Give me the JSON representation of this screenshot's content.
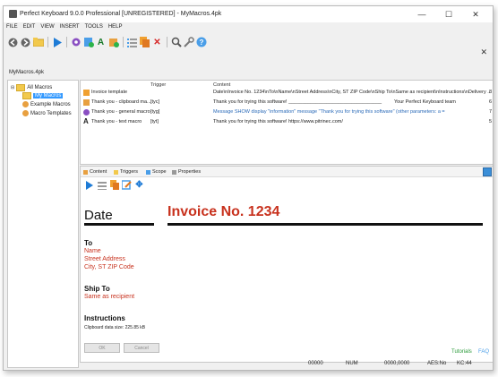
{
  "window": {
    "title": "Perfect Keyboard 9.0.0 Professional [UNREGISTERED] - MyMacros.4pk",
    "minimize": "—",
    "maximize": "☐",
    "close": "✕"
  },
  "menu": [
    "FILE",
    "EDIT",
    "VIEW",
    "INSERT",
    "TOOLS",
    "HELP"
  ],
  "close_x": "✕",
  "path_label": "MyMacros.4pk",
  "tree": {
    "root": "All Macros",
    "items": [
      "My Macros",
      "Example Macros",
      "Macro Templates"
    ]
  },
  "list": {
    "headers": {
      "trigger": "Trigger",
      "content": "Content",
      "num": "#"
    },
    "rows": [
      {
        "name": "Invoice template",
        "trigger": "",
        "content": "Date\\nInvoice No. 1234\\nTo\\nName\\nStreet Address\\nCity, ST ZIP Code\\nShip To\\nSame as recipient\\nInstructions\\nDelivery ...",
        "content2": "",
        "num": "8"
      },
      {
        "name": "Thank you - clipboard ma...",
        "trigger": "[tyc]",
        "content": "Thank you for trying this software! __________________________________",
        "content2": "Your Perfect Keyboard team",
        "num": "6"
      },
      {
        "name": "Thank you - general macro",
        "trigger": "[tyg]",
        "content": "Message SHOW display \"information\" message \"Thank you for trying this software\" (other parameters: a =",
        "content2": "",
        "num": "7"
      },
      {
        "name": "Thank you - text macro",
        "trigger": "[tyt]",
        "content": "Thank you for trying this software! https://www.pitrinec.com/",
        "content2": "",
        "num": "5"
      }
    ]
  },
  "editor": {
    "tabs": [
      "Content",
      "Triggers",
      "Scope",
      "Properties"
    ],
    "date_label": "Date",
    "invoice_title": "Invoice No. 1234",
    "to_label": "To",
    "to_lines": [
      "Name",
      "Street Address",
      "City, ST ZIP Code"
    ],
    "ship_label": "Ship To",
    "ship_line": "Same as recipient",
    "instructions_label": "Instructions",
    "clipboard_size": "Clipboard data size: 225.85 kB",
    "ok": "OK",
    "cancel": "Cancel"
  },
  "status": {
    "tutorials": "Tutorials",
    "faq": "FAQ",
    "s1": "00000",
    "s2": "NUM",
    "s3": "0000,0000",
    "s4": "AES:No",
    "s5": "KC:44"
  },
  "colors": {
    "accent_red": "#c8321e",
    "selection": "#3399ff",
    "tutorials": "#2a9a3a"
  }
}
